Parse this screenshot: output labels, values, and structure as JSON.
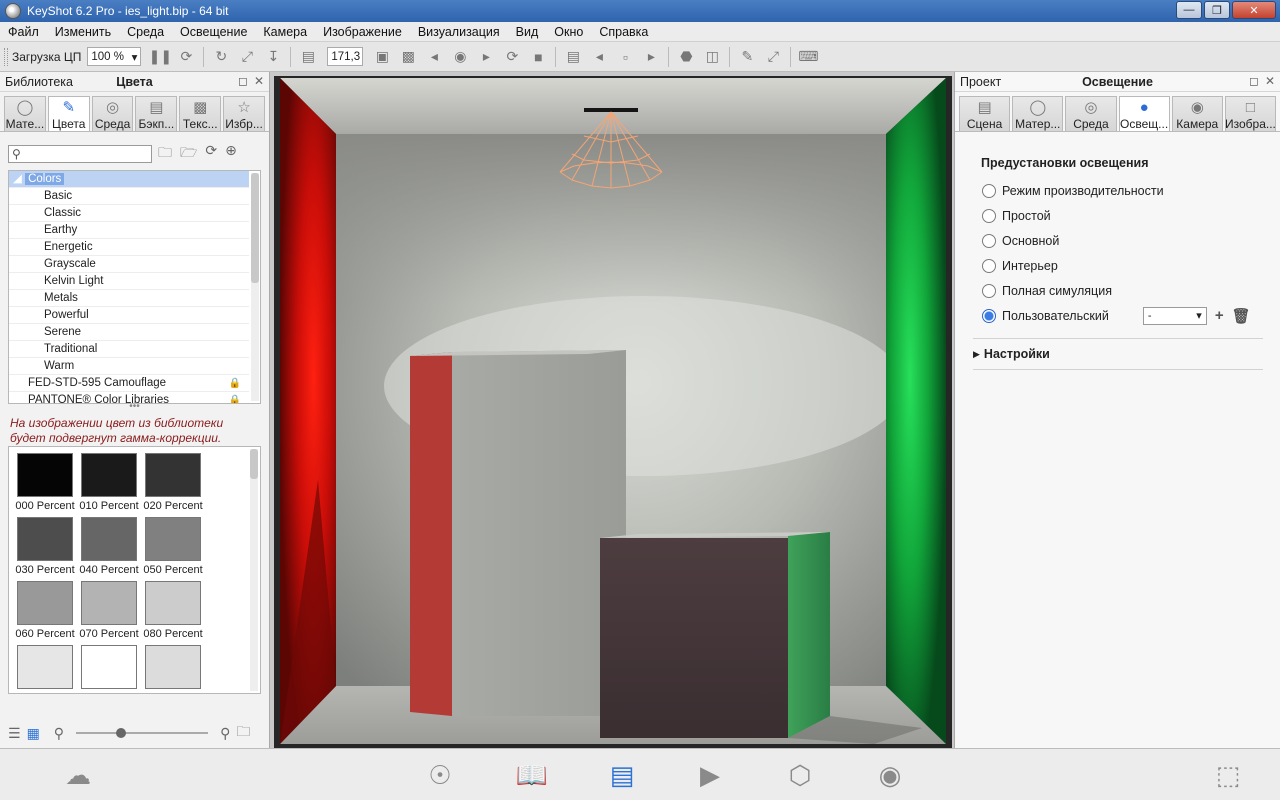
{
  "window": {
    "title": "KeyShot 6.2 Pro  - ies_light.bip  - 64 bit"
  },
  "menu": [
    "Файл",
    "Изменить",
    "Среда",
    "Освещение",
    "Камера",
    "Изображение",
    "Визуализация",
    "Вид",
    "Окно",
    "Справка"
  ],
  "toolbar": {
    "load_label": "Загрузка ЦП",
    "zoom_value": "100 %",
    "field_value": "171,3"
  },
  "left_panel": {
    "title": "Библиотека",
    "subtitle": "Цвета",
    "tabs": [
      {
        "label": "Мате...",
        "icon": "material-icon"
      },
      {
        "label": "Цвета",
        "icon": "color-icon",
        "active": true
      },
      {
        "label": "Среда",
        "icon": "environment-icon"
      },
      {
        "label": "Бэкп...",
        "icon": "backplate-icon"
      },
      {
        "label": "Текс...",
        "icon": "texture-icon"
      },
      {
        "label": "Избр...",
        "icon": "favorites-icon"
      }
    ],
    "tree": {
      "root": "Colors",
      "children": [
        "Basic",
        "Classic",
        "Earthy",
        "Energetic",
        "Grayscale",
        "Kelvin Light",
        "Metals",
        "Powerful",
        "Serene",
        "Traditional",
        "Warm"
      ],
      "extra": [
        {
          "label": "FED-STD-595 Camouflage",
          "locked": true
        },
        {
          "label": "PANTONE® Color Libraries",
          "locked": true
        }
      ]
    },
    "gamma_note": "На изображении цвет из библиотеки будет подвергнут гамма-коррекции.",
    "swatches": [
      {
        "label": "000 Percent",
        "color": "#050505"
      },
      {
        "label": "010 Percent",
        "color": "#1a1a1a"
      },
      {
        "label": "020 Percent",
        "color": "#333333"
      },
      {
        "label": "030 Percent",
        "color": "#4d4d4d"
      },
      {
        "label": "040 Percent",
        "color": "#666666"
      },
      {
        "label": "050 Percent",
        "color": "#808080"
      },
      {
        "label": "060 Percent",
        "color": "#999999"
      },
      {
        "label": "070 Percent",
        "color": "#b3b3b3"
      },
      {
        "label": "080 Percent",
        "color": "#cccccc"
      },
      {
        "label": "",
        "color": "#e6e6e6"
      },
      {
        "label": "",
        "color": "#ffffff"
      },
      {
        "label": "",
        "color": "#dcdcdc"
      }
    ]
  },
  "right_panel": {
    "title": "Проект",
    "subtitle": "Освещение",
    "tabs": [
      {
        "label": "Сцена",
        "icon": "scene-icon"
      },
      {
        "label": "Матер...",
        "icon": "material-icon"
      },
      {
        "label": "Среда",
        "icon": "environment-icon"
      },
      {
        "label": "Освещ...",
        "icon": "lighting-icon",
        "active": true
      },
      {
        "label": "Камера",
        "icon": "camera-icon"
      },
      {
        "label": "Изобра...",
        "icon": "image-icon"
      }
    ],
    "presets_title": "Предустановки освещения",
    "presets": [
      {
        "label": "Режим производительности",
        "selected": false
      },
      {
        "label": "Простой",
        "selected": false
      },
      {
        "label": "Основной",
        "selected": false
      },
      {
        "label": "Интерьер",
        "selected": false
      },
      {
        "label": "Полная симуляция",
        "selected": false
      },
      {
        "label": "Пользовательский",
        "selected": true
      }
    ],
    "custom_select_value": "-",
    "settings_label": "Настройки"
  },
  "colors": {
    "accent": "#2b72d6",
    "note": "#8a1b1b"
  }
}
